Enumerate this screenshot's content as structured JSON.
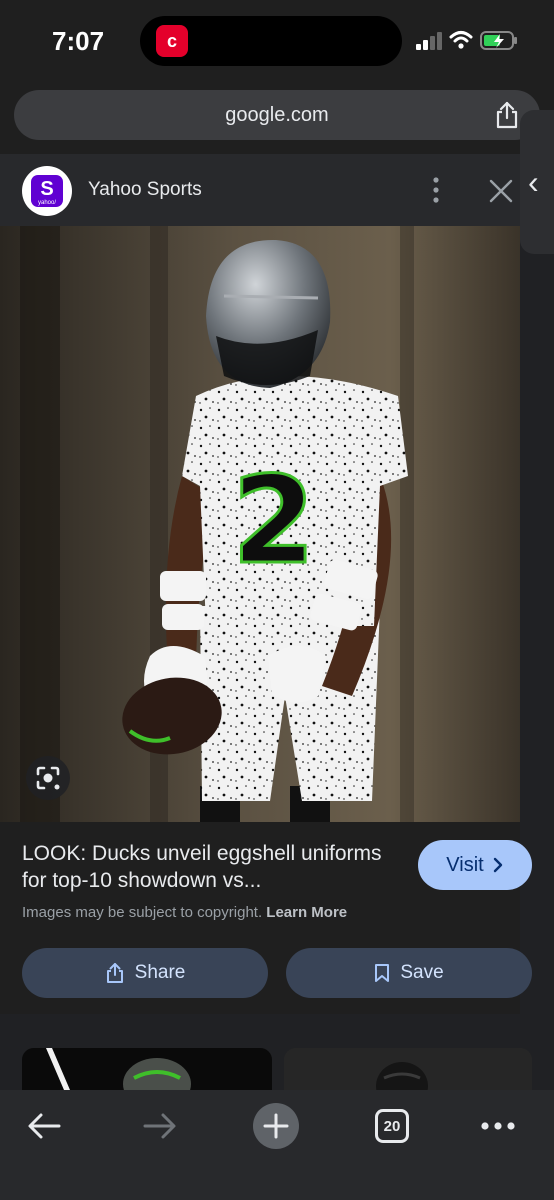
{
  "status_bar": {
    "time": "7:07",
    "island_app_glyph": "c",
    "island_app_icon": "chick-fil-a-icon"
  },
  "browser": {
    "url": "google.com",
    "open_tabs": "20"
  },
  "source": {
    "logo_letter": "S",
    "logo_subtext": "yahoo/",
    "name": "Yahoo Sports"
  },
  "result": {
    "title": "LOOK: Ducks unveil eggshell uniforms for top-10 showdown vs...",
    "copyright_text": "Images may be subject to copyright.",
    "learn_more_label": "Learn More",
    "visit_label": "Visit",
    "share_label": "Share",
    "save_label": "Save",
    "jersey_number": "2"
  },
  "colors": {
    "accent": "#a8c7fa",
    "action_bg": "#394457",
    "yahoo_purple": "#6001d2",
    "jersey_green": "#3fbf2a"
  },
  "icons": [
    "signal-icon",
    "wifi-icon",
    "battery-charging-icon",
    "share-icon",
    "more-vert-icon",
    "close-icon",
    "google-lens-icon",
    "chevron-right-icon",
    "bookmark-icon",
    "back-arrow-icon",
    "forward-arrow-icon",
    "new-tab-icon",
    "tab-switcher-icon",
    "more-horiz-icon"
  ]
}
